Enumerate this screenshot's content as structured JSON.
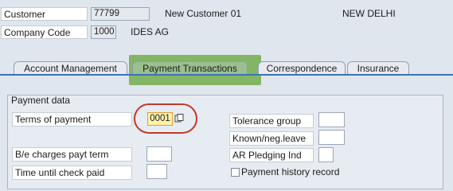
{
  "header": {
    "customer_label": "Customer",
    "customer_value": "77799",
    "customer_name": "New Customer 01",
    "city": "NEW DELHI",
    "company_code_label": "Company Code",
    "company_code_value": "1000",
    "company_name": "IDES AG"
  },
  "tabs": [
    {
      "label": "Account Management"
    },
    {
      "label": "Payment Transactions",
      "active": true
    },
    {
      "label": "Correspondence"
    },
    {
      "label": "Insurance"
    }
  ],
  "payment_data": {
    "title": "Payment data",
    "terms_of_payment_label": "Terms of payment",
    "terms_of_payment_value": "0001",
    "be_charges_label": "B/e charges payt term",
    "be_charges_value": "",
    "time_until_check_label": "Time until check paid",
    "time_until_check_value": "",
    "tolerance_group_label": "Tolerance group",
    "tolerance_group_value": "",
    "known_neg_leave_label": "Known/neg.leave",
    "known_neg_leave_value": "",
    "ar_pledging_label": "AR Pledging Ind",
    "ar_pledging_value": "",
    "payment_history_label": "Payment history record",
    "payment_history_checked": false
  },
  "colors": {
    "highlight": "#6faa46",
    "annotation_oval": "#c0392b",
    "tab_border": "#3a73b6"
  },
  "icons": {
    "matchcode": "value-help-icon"
  }
}
